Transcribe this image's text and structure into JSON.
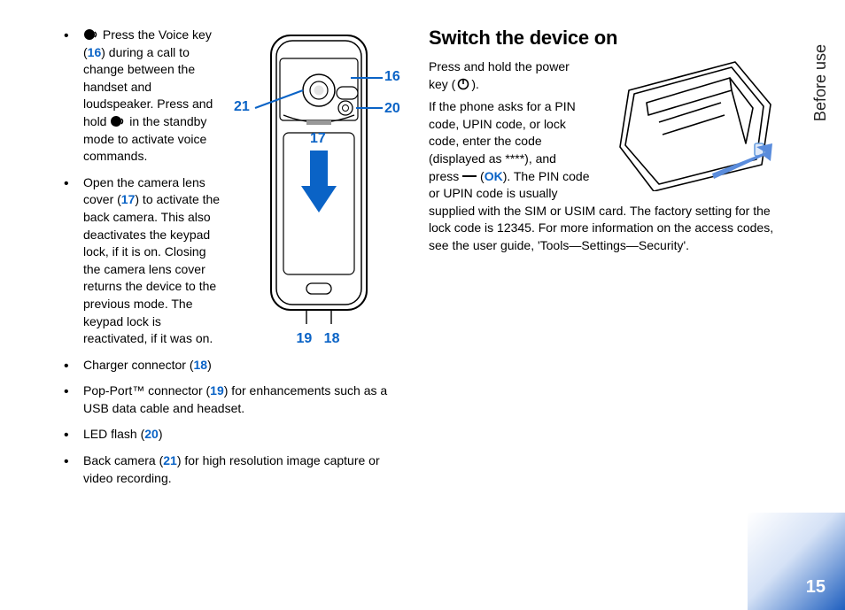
{
  "sideTab": "Before use",
  "pageNumber": "15",
  "left": {
    "bullets": [
      {
        "part1": " Press the Voice key (",
        "ref1": "16",
        "part2": ") during a call to change between the handset and loudspeaker. Press and hold ",
        "part3": " in the standby mode to activate voice commands."
      },
      {
        "part1": "Open the camera lens cover (",
        "ref1": "17",
        "part2": ") to activate the back camera. This also deactivates the keypad lock, if it is on. Closing the camera lens cover returns the device to the previous mode. The keypad lock is reactivated, if it was on."
      },
      {
        "part1": "Charger connector (",
        "ref1": "18",
        "part2": ")"
      },
      {
        "part1": "Pop-Port™ connector (",
        "ref1": "19",
        "part2": ") for enhancements such as a USB data cable and headset."
      },
      {
        "part1": "LED flash (",
        "ref1": "20",
        "part2": ")"
      },
      {
        "part1": "Back camera (",
        "ref1": "21",
        "part2": ") for high resolution image capture or video recording."
      }
    ],
    "callouts": {
      "c16": "16",
      "c17": "17",
      "c18": "18",
      "c19": "19",
      "c20": "20",
      "c21": "21"
    }
  },
  "right": {
    "heading": "Switch the device on",
    "para1a": "Press and hold the power key (",
    "para1b": ").",
    "para2a": "If the phone asks for a PIN code, UPIN code, or lock code, enter the code (displayed as ****), and press ",
    "para2b": " (",
    "ok": "OK",
    "para2c": "). The PIN code or UPIN code is usually supplied with the SIM or USIM card. The factory setting for the lock code is 12345. For more information on the access codes, see the user guide, 'Tools—Settings—Security'."
  }
}
